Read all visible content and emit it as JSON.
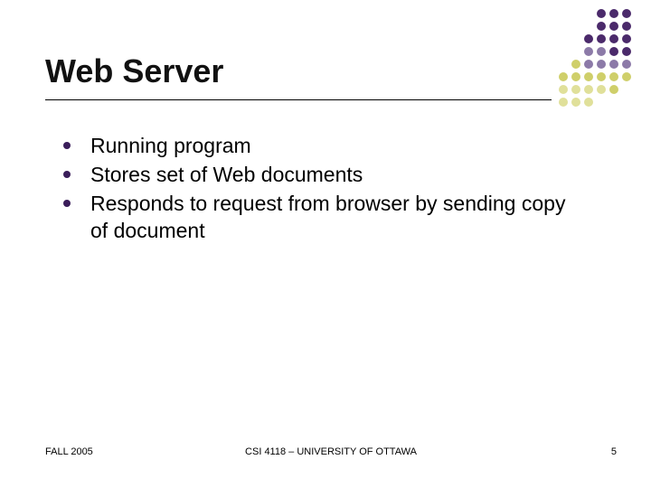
{
  "title": "Web Server",
  "bullets": [
    "Running program",
    "Stores set of Web documents",
    "Responds to request from browser by sending copy of document"
  ],
  "footer": {
    "left": "FALL 2005",
    "center": "CSI 4118 – UNIVERSITY OF OTTAWA",
    "right": "5"
  },
  "colors": {
    "bullet": "#3a1d5a",
    "accent_dark": "#4b2a6b",
    "accent_olive": "#cfcf6a"
  }
}
